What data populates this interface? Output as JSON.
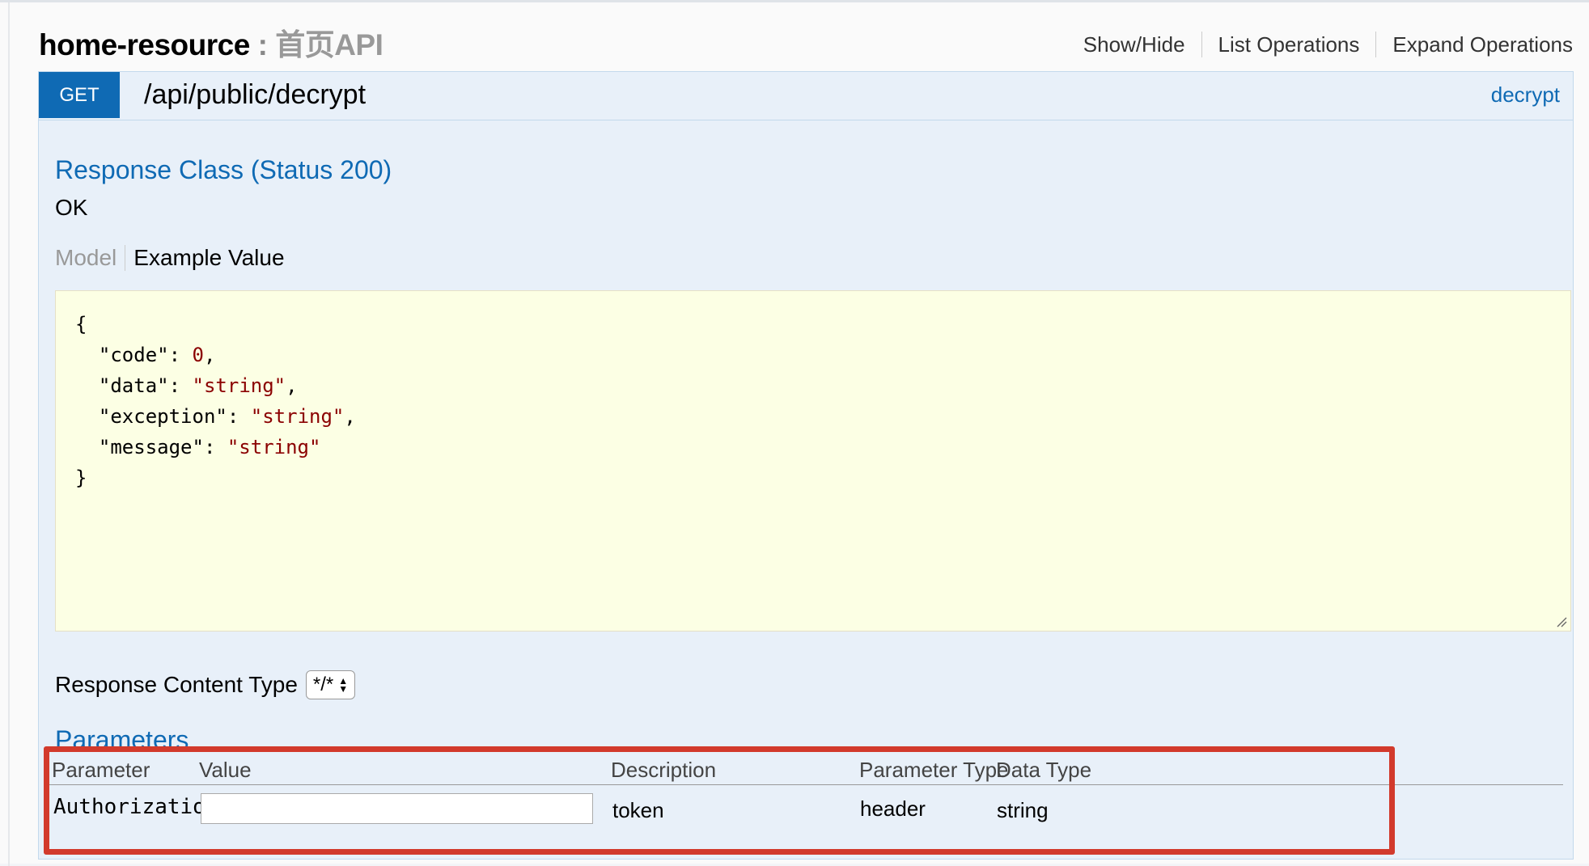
{
  "resource": {
    "name": "home-resource",
    "separator": ":",
    "description": "首页API",
    "links": [
      "Show/Hide",
      "List Operations",
      "Expand Operations"
    ]
  },
  "operation": {
    "method": "GET",
    "path": "/api/public/decrypt",
    "nickname": "decrypt"
  },
  "response": {
    "title": "Response Class (Status 200)",
    "status_text": "OK",
    "tabs": [
      "Model",
      "Example Value"
    ],
    "example_lines": [
      {
        "text": "{"
      },
      {
        "key": "\"code\"",
        "value": "0",
        "suffix": ","
      },
      {
        "key": "\"data\"",
        "value": "\"string\"",
        "suffix": ","
      },
      {
        "key": "\"exception\"",
        "value": "\"string\"",
        "suffix": ","
      },
      {
        "key": "\"message\"",
        "value": "\"string\"",
        "suffix": ""
      },
      {
        "text": "}"
      }
    ],
    "content_type_label": "Response Content Type",
    "content_type_value": "*/*"
  },
  "parameters": {
    "title": "Parameters",
    "columns": [
      "Parameter",
      "Value",
      "Description",
      "Parameter Type",
      "Data Type"
    ],
    "rows": [
      {
        "name": "Authorization",
        "value": "",
        "description": "token",
        "param_type": "header",
        "data_type": "string"
      }
    ]
  },
  "colors": {
    "get_method": "#0f6ab4",
    "link_blue": "#0f6ab4",
    "highlight_red": "#d23a2c",
    "example_bg": "#fcffe4"
  }
}
